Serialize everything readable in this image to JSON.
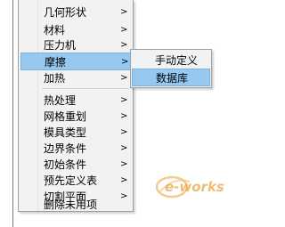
{
  "context_menu": {
    "items": [
      {
        "label": "几何形状",
        "arrow": ">"
      },
      {
        "label": "材料",
        "arrow": ">"
      },
      {
        "label": "压力机",
        "arrow": ">"
      },
      {
        "label": "摩擦",
        "arrow": ">"
      },
      {
        "label": "加热",
        "arrow": ">"
      },
      {
        "label": "热处理",
        "arrow": ">"
      },
      {
        "label": "网格重划",
        "arrow": ">"
      },
      {
        "label": "模具类型",
        "arrow": ">"
      },
      {
        "label": "边界条件",
        "arrow": ">"
      },
      {
        "label": "初始条件",
        "arrow": ">"
      },
      {
        "label": "预先定义表",
        "arrow": ">"
      },
      {
        "label": "切割平面",
        "arrow": ">"
      },
      {
        "label": "删除未用项"
      }
    ]
  },
  "submenu": {
    "items": [
      {
        "label": "手动定义"
      },
      {
        "label": "数据库"
      }
    ]
  },
  "watermark": {
    "text": "e-works",
    "brand_color": "#e8a23a"
  },
  "colors": {
    "highlight": "#96c8f0",
    "menu_background": "#f2f2f2"
  }
}
